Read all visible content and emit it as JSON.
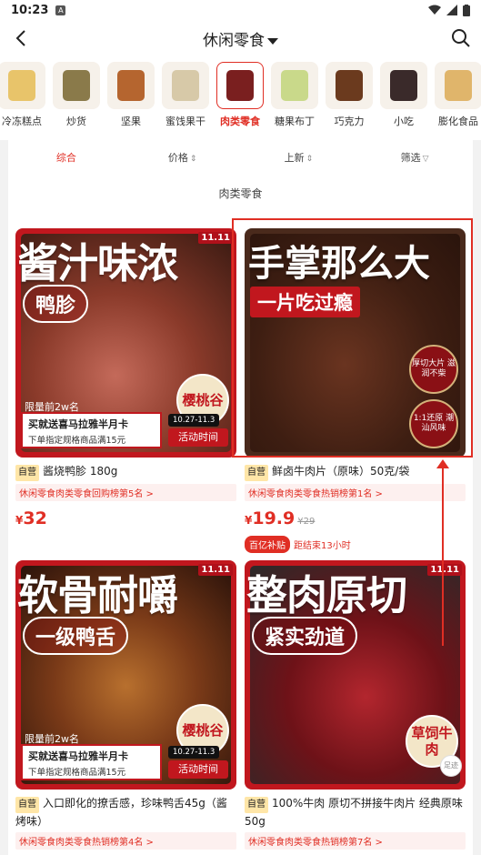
{
  "status": {
    "time": "10:23",
    "a_badge": "A"
  },
  "header": {
    "title": "休闲零食"
  },
  "categories": [
    {
      "label": "冷冻糕点",
      "color": "#e8c46a"
    },
    {
      "label": "炒货",
      "color": "#8a7a4a"
    },
    {
      "label": "坚果",
      "color": "#b5652f"
    },
    {
      "label": "蜜饯果干",
      "color": "#d7c9a8"
    },
    {
      "label": "肉类零食",
      "color": "#7a1f1f"
    },
    {
      "label": "糖果布丁",
      "color": "#c9d98a"
    },
    {
      "label": "巧克力",
      "color": "#6b3a1e"
    },
    {
      "label": "小吃",
      "color": "#3a2a2a"
    },
    {
      "label": "膨化食品",
      "color": "#e0b56b"
    }
  ],
  "sort": {
    "comprehensive": "综合",
    "price": "价格",
    "new": "上新",
    "filter": "筛选"
  },
  "section_title": "肉类零食",
  "products": [
    {
      "headline": "酱汁味浓",
      "pill": "鸭胗",
      "badge": "11.11",
      "round_tag": "樱桃谷",
      "limit": "限量前2w名",
      "promo_l1": "买就送喜马拉雅半月卡",
      "promo_l2": "下单指定规格商品满15元",
      "promo_date": "10.27-11.3",
      "promo_act": "活动时间",
      "self_tag": "自营",
      "name": "酱烧鸭胗 180g",
      "rank": "休闲零食肉类零食回购榜第5名 >",
      "price_yen": "¥",
      "price": "32"
    },
    {
      "headline": "手掌那么大",
      "sub": "一片吃过瘾",
      "circle1": "厚切大片 滋润不柴",
      "circle2": "1:1还原 潮汕风味",
      "self_tag": "自营",
      "name": "鲜卤牛肉片（原味）50克/袋",
      "rank": "休闲零食肉类零食热销榜第1名 >",
      "price_yen": "¥",
      "price": "19.9",
      "orig": "¥29",
      "subsidy": "百亿补贴",
      "ends": "距结束13小时"
    },
    {
      "headline": "软骨耐嚼",
      "pill": "一级鸭舌",
      "badge": "11.11",
      "round_tag": "樱桃谷",
      "limit": "限量前2w名",
      "promo_l1": "买就送喜马拉雅半月卡",
      "promo_l2": "下单指定规格商品满15元",
      "promo_date": "10.27-11.3",
      "promo_act": "活动时间",
      "self_tag": "自营",
      "name": "入口即化的撩舌感，珍味鸭舌45g（酱烤味）",
      "rank": "休闲零食肉类零食热销榜第4名 >"
    },
    {
      "headline": "整肉原切",
      "pill": "紧实劲道",
      "badge": "11.11",
      "round_tag": "草饲牛肉",
      "self_tag": "自营",
      "name": "100%牛肉 原切不拼接牛肉片 经典原味50g",
      "rank": "休闲零食肉类零食热销榜第7名 >",
      "foot": "足迹"
    }
  ]
}
